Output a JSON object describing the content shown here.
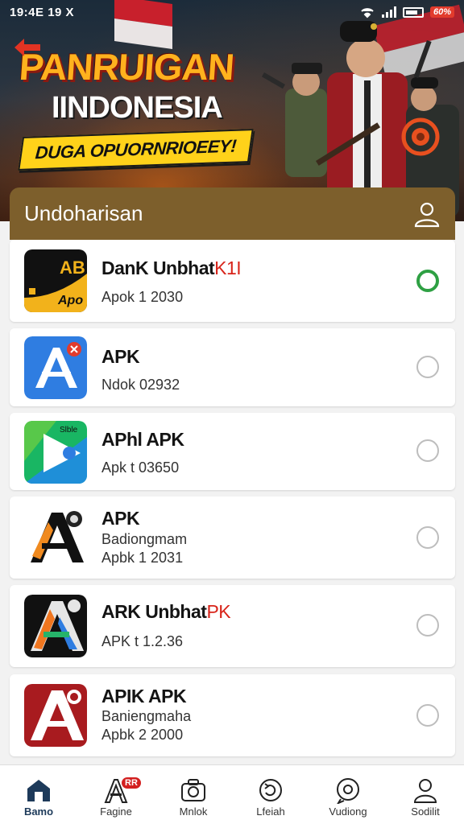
{
  "status_bar": {
    "time": "19:4E 19 X",
    "battery_label": "60%"
  },
  "hero": {
    "title_line1": "PANRUIGAN",
    "title_line2": "IINDONESIA",
    "ribbon": "DUGA OPUORNRIOEEY!"
  },
  "list": {
    "header_title": "Undoharisan",
    "items": [
      {
        "name": "DanK Unbhat",
        "name_accent": "K1I",
        "line1": "Apok 1 2030",
        "line2": "",
        "selected": true,
        "icon": "app-ab-icon"
      },
      {
        "name": "APK",
        "name_accent": "",
        "line1": "Ndok 02932",
        "line2": "",
        "selected": false,
        "icon": "app-store-a-icon"
      },
      {
        "name": "APhl APK",
        "name_accent": "",
        "line1": "Apk t 03650",
        "line2": "",
        "selected": false,
        "icon": "play-store-icon"
      },
      {
        "name": "APK",
        "name_accent": "",
        "line1": "Badiongmam",
        "line2": "Apbk 1 2031",
        "selected": false,
        "icon": "app-a-orange-icon"
      },
      {
        "name": "ARK Unbhat",
        "name_accent": "PK",
        "line1": "APK t 1.2.36",
        "line2": "",
        "selected": false,
        "icon": "app-a-blue-icon"
      },
      {
        "name": "APIK APK",
        "name_accent": "",
        "line1": "Baniengmaha",
        "line2": "Apbk 2 2000",
        "selected": false,
        "icon": "app-a-red-icon"
      }
    ]
  },
  "nav": {
    "items": [
      {
        "label": "Bamo",
        "icon": "home-icon"
      },
      {
        "label": "Fagine",
        "icon": "apps-icon",
        "badge": "RR"
      },
      {
        "label": "Mnlok",
        "icon": "camera-icon"
      },
      {
        "label": "Lfeiah",
        "icon": "refresh-icon"
      },
      {
        "label": "Vudiong",
        "icon": "chat-icon"
      },
      {
        "label": "Sodilit",
        "icon": "profile-icon"
      }
    ]
  },
  "colors": {
    "header_bg": "#7d5f2c",
    "selected_radio": "#2ea043",
    "accent_red": "#d8241a"
  }
}
